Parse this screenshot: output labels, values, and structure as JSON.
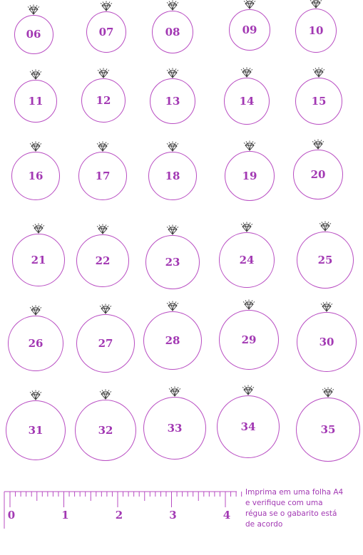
{
  "colors": {
    "ring": "#b84cc2",
    "label": "#a238b3",
    "diamond": "#333333"
  },
  "rings": [
    "06",
    "07",
    "08",
    "09",
    "10",
    "11",
    "12",
    "13",
    "14",
    "15",
    "16",
    "17",
    "18",
    "19",
    "20",
    "21",
    "22",
    "23",
    "24",
    "25",
    "26",
    "27",
    "28",
    "29",
    "30",
    "31",
    "32",
    "33",
    "34",
    "35"
  ],
  "ruler": {
    "numbers": [
      "0",
      "1",
      "2",
      "3",
      "4"
    ]
  },
  "note": {
    "lines": [
      "Imprima em uma folha A4",
      "e verifique com uma",
      "régua se o gabarito está",
      "de acordo"
    ]
  }
}
